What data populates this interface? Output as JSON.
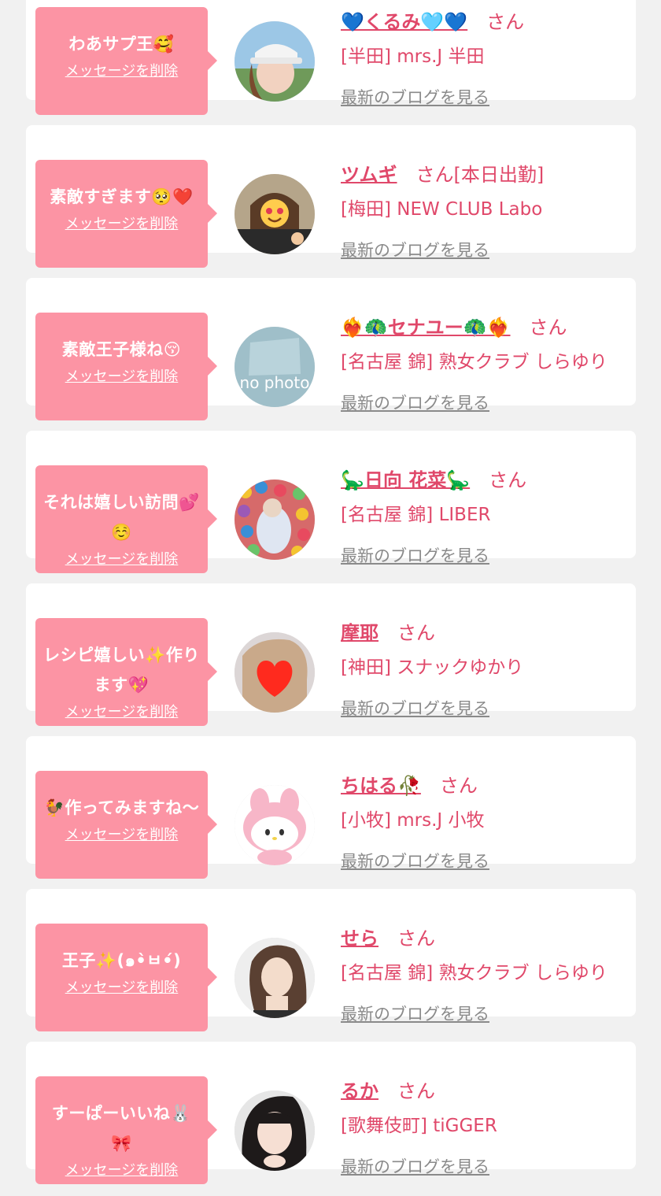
{
  "delete_label": "メッセージを削除",
  "san_label": "さん",
  "blog_label": "最新のブログを見る",
  "colors": {
    "background": "#f1f1f1",
    "card": "#ffffff",
    "bubble": "#fc94a4",
    "accent": "#e0486a",
    "link_gray": "#8a8a8a"
  },
  "messages": [
    {
      "text": "わあサプ王🥰",
      "name": "💙くるみ🩵💙",
      "suffix": "",
      "shop": "[半田] mrs.J 半田",
      "avatar": "photo-woman-cap"
    },
    {
      "text": "素敵すぎます🥺❤️",
      "name": "ツムギ",
      "suffix": "[本日出勤]",
      "shop": "[梅田] NEW CLUB Labo",
      "avatar": "photo-woman-emoji-face"
    },
    {
      "text": "素敵王子様ね😚",
      "name": "❤️‍🔥🦚セナユー🦚❤️‍🔥",
      "suffix": "",
      "shop": "[名古屋 錦] 熟女クラブ しらゆり",
      "avatar": "no-photo"
    },
    {
      "text": "それは嬉しい訪問💕☺️",
      "name": "🦕日向 花菜🦕",
      "suffix": "",
      "shop": "[名古屋 錦] LIBER",
      "avatar": "photo-ball-pit"
    },
    {
      "text": "レシピ嬉しい✨作ります💖",
      "name": "摩耶",
      "suffix": "",
      "shop": "[神田] スナックゆかり",
      "avatar": "photo-heart-face"
    },
    {
      "text": "🐓作ってみますね〜",
      "name": "ちはる🥀",
      "suffix": "",
      "shop": "[小牧] mrs.J 小牧",
      "avatar": "plush-my-melody"
    },
    {
      "text": "王子✨(๑•̀ㅂ•́)",
      "name": "せら",
      "suffix": "",
      "shop": "[名古屋 錦] 熟女クラブ しらゆり",
      "avatar": "photo-woman-portrait"
    },
    {
      "text": "すーぱーいいね🐰🎀",
      "name": "るか",
      "suffix": "",
      "shop": "[歌舞伎町] tiGGER",
      "avatar": "photo-woman-closeup"
    }
  ]
}
